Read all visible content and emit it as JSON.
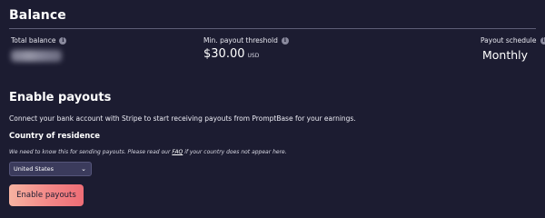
{
  "balance": {
    "title": "Balance",
    "total_label": "Total balance",
    "threshold_label": "Min. payout threshold",
    "threshold_amount": "$30.00",
    "threshold_currency": "USD",
    "schedule_label": "Payout schedule",
    "schedule_value": "Monthly"
  },
  "payouts": {
    "title": "Enable payouts",
    "description": "Connect your bank account with Stripe to start receiving payouts from PromptBase for your earnings.",
    "country_title": "Country of residence",
    "note_before": "We need to know this for sending payouts. Please read our ",
    "note_link": "FAQ",
    "note_after": " if your country does not appear here.",
    "country_selected": "United States",
    "button_label": "Enable payouts"
  },
  "colors": {
    "background": "#1c1c31",
    "select_bg": "#3b3b5c",
    "button_gradient_start": "#f7b3a1",
    "button_gradient_end": "#ee6d76"
  }
}
